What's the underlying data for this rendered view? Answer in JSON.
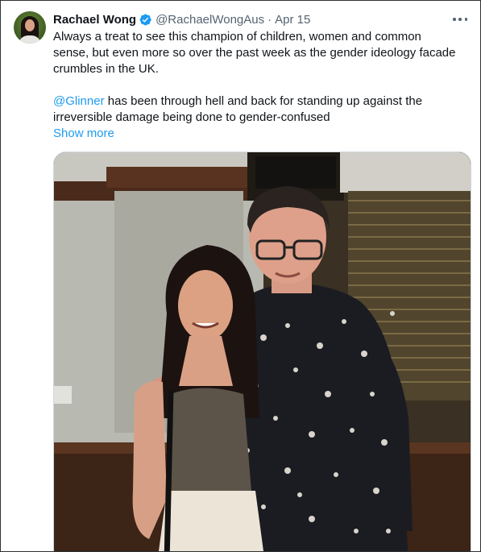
{
  "tweet": {
    "author_name": "Rachael Wong",
    "handle": "@RachaelWongAus",
    "separator": "·",
    "date": "Apr 15",
    "text_line_1": "Always a treat to see this champion of children, women and common sense, but even more so over the past week as the gender ideology facade crumbles in the UK.",
    "mention": "@Glinner",
    "text_line_2_rest": " has been through hell and back for standing up against the irreversible damage being done to gender-confused",
    "show_more_label": "Show more"
  },
  "icons": {
    "verified": "verified-badge-icon",
    "more": "more-options-icon"
  },
  "colors": {
    "accent": "#1d9bf0",
    "text": "#0f1419",
    "muted": "#536471"
  }
}
